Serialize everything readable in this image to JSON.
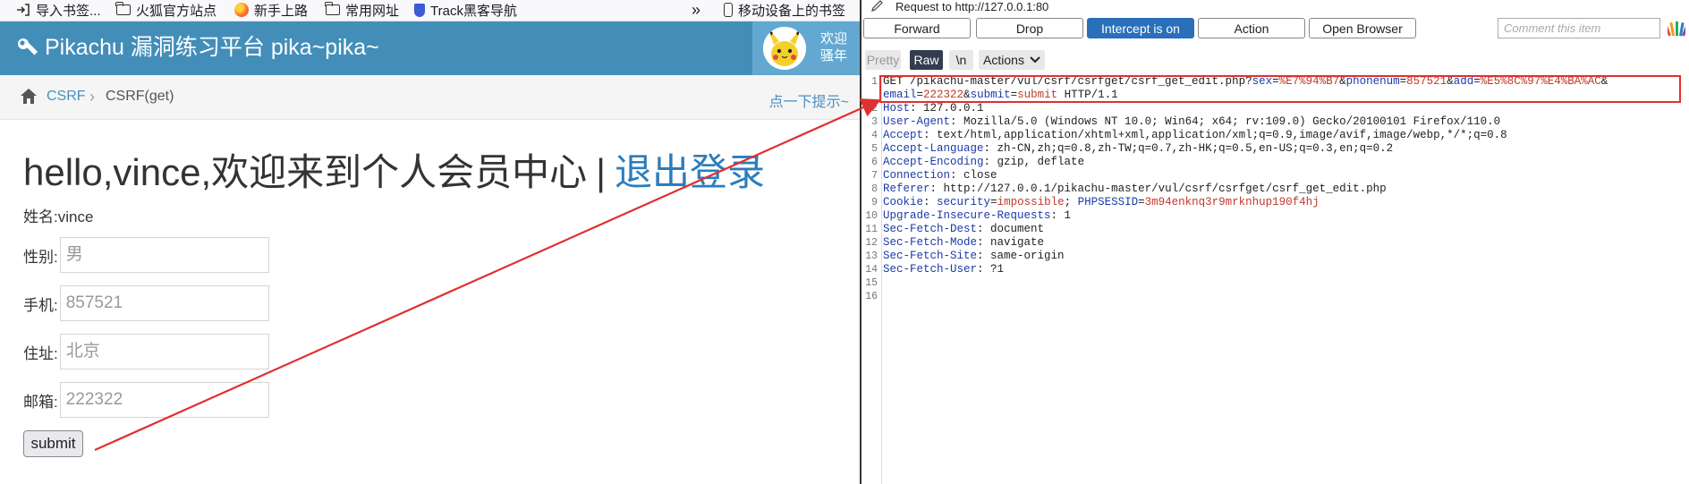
{
  "bookmarks": [
    {
      "label": "导入书签...",
      "icon": "import-icon"
    },
    {
      "label": "火狐官方站点",
      "icon": "folder-icon"
    },
    {
      "label": "新手上路",
      "icon": "firefox-icon"
    },
    {
      "label": "常用网址",
      "icon": "folder-icon"
    },
    {
      "label": "Track黑客导航",
      "icon": "shield-icon"
    },
    {
      "label": "移动设备上的书签",
      "icon": "mobile-icon"
    }
  ],
  "site": {
    "title": "Pikachu 漏洞练习平台 pika~pika~",
    "user_line1": "欢迎",
    "user_line2": "骚年",
    "header_color": "#438eb9"
  },
  "breadcrumb": {
    "link": "CSRF",
    "separator": "›",
    "current": "CSRF(get)",
    "hint": "点一下提示~"
  },
  "page": {
    "welcome": "hello,vince,欢迎来到个人会员中心",
    "separator": "|",
    "logout": "退出登录",
    "name_line": "姓名:vince",
    "fields": [
      {
        "label": "性别:",
        "placeholder": "男"
      },
      {
        "label": "手机:",
        "placeholder": "857521"
      },
      {
        "label": "住址:",
        "placeholder": "北京"
      },
      {
        "label": "邮箱:",
        "placeholder": "222322"
      }
    ],
    "submit": "submit"
  },
  "burp": {
    "request_title": "Request to http://127.0.0.1:80",
    "buttons": {
      "forward": "Forward",
      "drop": "Drop",
      "intercept": "Intercept is on",
      "action": "Action",
      "open_browser": "Open Browser"
    },
    "comment_placeholder": "Comment this item",
    "tabs": {
      "pretty": "Pretty",
      "raw": "Raw",
      "newline": "\\n",
      "actions": "Actions"
    },
    "request_line": {
      "method_path": "GET /pikachu-master/vul/csrf/csrfget/csrf_get_edit.php?",
      "params": [
        {
          "name": "sex",
          "value": "%E7%94%B7"
        },
        {
          "name": "phonenum",
          "value": "857521"
        },
        {
          "name": "add",
          "value": "%E5%8C%97%E4%BA%AC"
        },
        {
          "name": "email",
          "value": "222322"
        },
        {
          "name": "submit",
          "value": "submit"
        }
      ],
      "protocol": " HTTP/1.1"
    },
    "headers": [
      {
        "name": "Host",
        "value": " 127.0.0.1"
      },
      {
        "name": "User-Agent",
        "value": " Mozilla/5.0 (Windows NT 10.0; Win64; x64; rv:109.0) Gecko/20100101 Firefox/110.0"
      },
      {
        "name": "Accept",
        "value": " text/html,application/xhtml+xml,application/xml;q=0.9,image/avif,image/webp,*/*;q=0.8"
      },
      {
        "name": "Accept-Language",
        "value": " zh-CN,zh;q=0.8,zh-TW;q=0.7,zh-HK;q=0.5,en-US;q=0.3,en;q=0.2"
      },
      {
        "name": "Accept-Encoding",
        "value": " gzip, deflate"
      },
      {
        "name": "Connection",
        "value": " close"
      },
      {
        "name": "Referer",
        "value": " http://127.0.0.1/pikachu-master/vul/csrf/csrfget/csrf_get_edit.php"
      },
      {
        "name": "Upgrade-Insecure-Requests",
        "value": " 1"
      },
      {
        "name": "Sec-Fetch-Dest",
        "value": " document"
      },
      {
        "name": "Sec-Fetch-Mode",
        "value": " navigate"
      },
      {
        "name": "Sec-Fetch-Site",
        "value": " same-origin"
      },
      {
        "name": "Sec-Fetch-User",
        "value": " ?1"
      }
    ],
    "cookie": {
      "name": "Cookie",
      "pairs": [
        {
          "name": "security",
          "value": "impossible"
        },
        {
          "name": "PHPSESSID",
          "value": "3m94enknq3r9mrknhup190f4hj"
        }
      ]
    },
    "line_numbers": [
      "1",
      "2",
      "3",
      "4",
      "5",
      "6",
      "7",
      "8",
      "9",
      "10",
      "11",
      "12",
      "13",
      "14",
      "15",
      "16"
    ],
    "highlight_color": "#e03030"
  }
}
